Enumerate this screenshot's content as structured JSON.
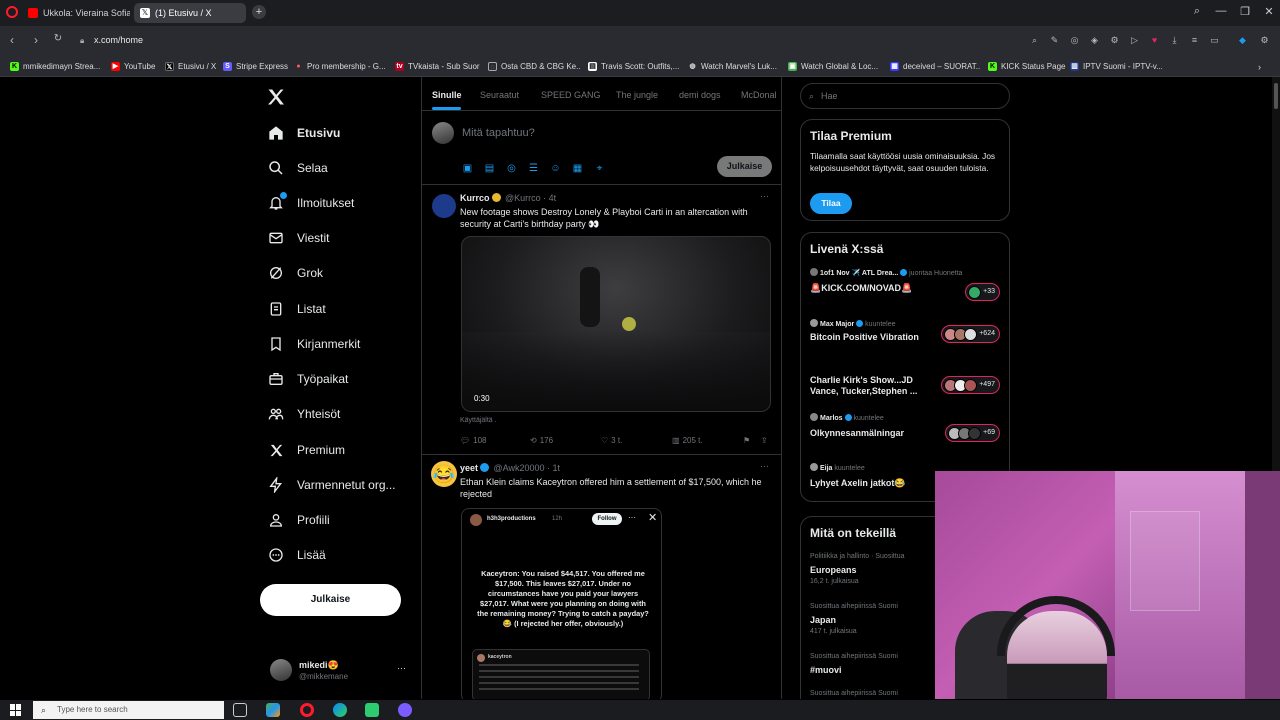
{
  "browser": {
    "tabs": [
      {
        "title": "Ukkola: Vieraina Sofia Virt",
        "active": false
      },
      {
        "title": "(1) Etusivu / X",
        "active": true
      }
    ],
    "url": "x.com/home",
    "bookmarks": [
      "mmikedimayn Strea...",
      "YouTube",
      "Etusivu / X",
      "Stripe Express",
      "Pro membership - G...",
      "TVkaista - Sub Suora",
      "Osta CBD & CBG Ke...",
      "Travis Scott: Outfits,...",
      "Watch Marvel's Luk...",
      "Watch Global & Loc...",
      "deceived – SUORAT...",
      "KICK Status Page",
      "IPTV Suomi - IPTV-v..."
    ]
  },
  "nav": {
    "items": [
      {
        "label": "Etusivu",
        "icon": "home-icon",
        "active": true
      },
      {
        "label": "Selaa",
        "icon": "search-icon"
      },
      {
        "label": "Ilmoitukset",
        "icon": "bell-icon"
      },
      {
        "label": "Viestit",
        "icon": "mail-icon"
      },
      {
        "label": "Grok",
        "icon": "grok-icon"
      },
      {
        "label": "Listat",
        "icon": "list-icon"
      },
      {
        "label": "Kirjanmerkit",
        "icon": "bookmark-icon"
      },
      {
        "label": "Työpaikat",
        "icon": "briefcase-icon"
      },
      {
        "label": "Yhteisöt",
        "icon": "community-icon"
      },
      {
        "label": "Premium",
        "icon": "x-logo-icon"
      },
      {
        "label": "Varmennetut org...",
        "icon": "lightning-icon"
      },
      {
        "label": "Profiili",
        "icon": "profile-icon"
      },
      {
        "label": "Lisää",
        "icon": "more-circle-icon"
      }
    ],
    "post_button": "Julkaise",
    "account": {
      "name": "mikedi😍",
      "handle": "@mikkemane",
      "more": "···"
    }
  },
  "timeline": {
    "tabs": [
      "Sinulle",
      "Seuraatut",
      "SPEED GANG",
      "The jungle",
      "demi dogs",
      "McDonal"
    ],
    "compose": {
      "placeholder": "Mitä tapahtuu?",
      "post_button": "Julkaise"
    },
    "tweets": [
      {
        "name": "Kurrco",
        "handle": "@Kurrco · 4t",
        "text": "New footage shows Destroy Lonely & Playboi Carti in an altercation with security at Carti's birthday party 👀",
        "video_time": "0:30",
        "footnote": "Käyttäjältä .",
        "replies": "108",
        "reposts": "176",
        "likes": "3 t.",
        "views": "205 t."
      },
      {
        "name": "yeet",
        "handle": "@Awk20000 · 1t",
        "text": "Ethan Klein claims Kaceytron offered him a settlement of $17,500, which he rejected",
        "embed": {
          "account": "h3h3productions",
          "time": "12h",
          "follow": "Follow",
          "body": "Kaceytron: You raised $44,517. You offered me $17,500. This leaves $27,017. Under no circumstances have you paid your lawyers $27,017. What were you planning on doing with the remaining money? Trying to catch a payday? 😂 (I rejected her offer, obviously.)",
          "quoted": "kaceytron"
        }
      }
    ]
  },
  "sidebar": {
    "search_placeholder": "Hae",
    "premium": {
      "title": "Tilaa Premium",
      "text": "Tilaamalla saat käyttöösi uusia ominaisuuksia. Jos kelpoisuusehdot täyttyvät, saat osuuden tuloista.",
      "button": "Tilaa"
    },
    "live": {
      "title": "Livenä X:ssä",
      "items": [
        {
          "host": "1of1 Nov ✈️ ATL Drea...",
          "status": "juontaa Huonetta",
          "title": "🚨KICK.COM/NOVAD🚨",
          "count": "+33"
        },
        {
          "host": "Max Major",
          "status": "kuuntelee",
          "title": "Bitcoin Positive Vibration",
          "count": "+624"
        },
        {
          "host": "",
          "status": "",
          "title": "Charlie Kirk's Show...JD Vance, Tucker,Stephen ...",
          "count": "+497"
        },
        {
          "host": "Marlos",
          "status": "kuuntelee",
          "title": "Olkynnesanmälningar",
          "count": "+69"
        },
        {
          "host": "Eija",
          "status": "kuuntelee",
          "title": "Lyhyet Axelin jatkot😂",
          "count": ""
        }
      ]
    },
    "trends": {
      "title": "Mitä on tekeillä",
      "items": [
        {
          "context": "Politiikka ja hallinto · Suosittua",
          "name": "Europeans",
          "posts": "16,2 t. julkaisua"
        },
        {
          "context": "Suosittua aihepiirissä Suomi",
          "name": "Japan",
          "posts": "417 t. julkaisua"
        },
        {
          "context": "Suosittua aihepiirissä Suomi",
          "name": "#muovi",
          "posts": ""
        },
        {
          "context": "Suosittua aihepiirissä Suomi",
          "name": "",
          "posts": ""
        }
      ]
    }
  },
  "taskbar": {
    "search_placeholder": "Type here to search"
  },
  "colors": {
    "accent": "#1d9bf0",
    "background": "#000000",
    "border": "#2f3336",
    "muted": "#71767b",
    "live": "#e0245e"
  }
}
